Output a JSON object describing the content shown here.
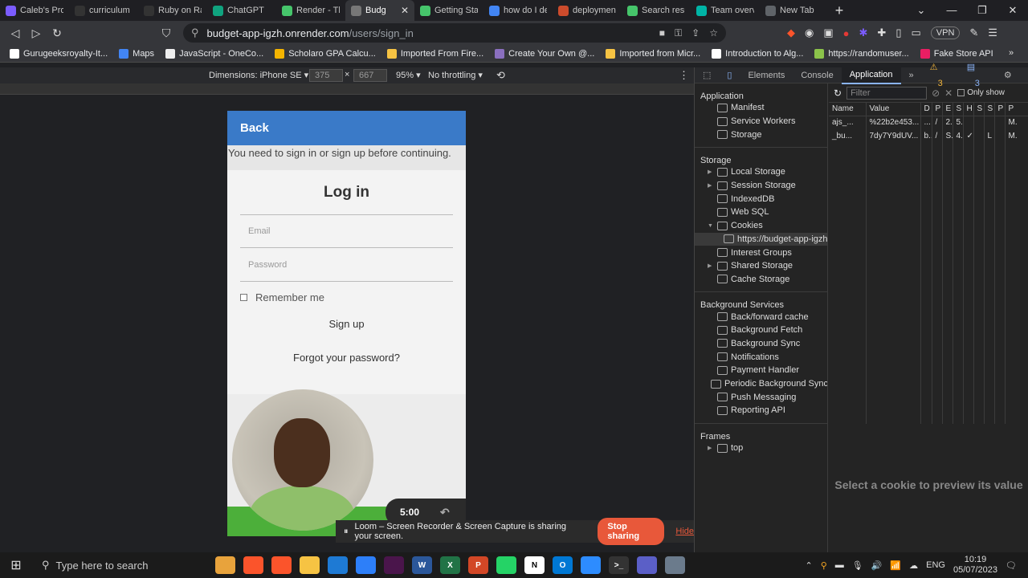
{
  "browser": {
    "tabs": [
      {
        "label": "Caleb's Prog",
        "color": "#7b5cff",
        "active": false
      },
      {
        "label": "curriculum",
        "color": "#333333",
        "active": false
      },
      {
        "label": "Ruby on Ra",
        "color": "#333333",
        "active": false
      },
      {
        "label": "ChatGPT",
        "color": "#10a37f",
        "active": false
      },
      {
        "label": "Render - The",
        "color": "#46c56b",
        "active": false
      },
      {
        "label": "Budg",
        "color": "#777777",
        "active": true
      },
      {
        "label": "Getting Star",
        "color": "#46c56b",
        "active": false
      },
      {
        "label": "how do I de",
        "color": "#4285f4",
        "active": false
      },
      {
        "label": "deployment",
        "color": "#cc4b2c",
        "active": false
      },
      {
        "label": "Search resul",
        "color": "#46c56b",
        "active": false
      },
      {
        "label": "Team overv",
        "color": "#00b4a6",
        "active": false
      },
      {
        "label": "New Tab",
        "color": "#5f6368",
        "active": false
      }
    ],
    "url_host": "budget-app-igzh.onrender.com",
    "url_path": "/users/sign_in",
    "vpn_label": "VPN",
    "bookmarks": [
      {
        "label": "Gurugeeksroyalty-It...",
        "color": "#ffffff"
      },
      {
        "label": "Maps",
        "color": "#4285f4"
      },
      {
        "label": "JavaScript - OneCo...",
        "color": "#eeeeee"
      },
      {
        "label": "Scholaro GPA Calcu...",
        "color": "#f4b400"
      },
      {
        "label": "Imported From Fire...",
        "color": "#f6c343"
      },
      {
        "label": "Create Your Own @...",
        "color": "#8a6fbf"
      },
      {
        "label": "Imported from Micr...",
        "color": "#f6c343"
      },
      {
        "label": "Introduction to Alg...",
        "color": "#ffffff"
      },
      {
        "label": "https://randomuser...",
        "color": "#8bc34a"
      },
      {
        "label": "Fake Store API",
        "color": "#e91e63"
      }
    ]
  },
  "device_toolbar": {
    "dimensions_label": "Dimensions: iPhone SE",
    "width": "375",
    "height": "667",
    "zoom": "95%",
    "throttle": "No throttling",
    "times": "×"
  },
  "phone": {
    "back_label": "Back",
    "notice": "You need to sign in or sign up before continuing.",
    "title": "Log in",
    "email_placeholder": "Email",
    "password_placeholder": "Password",
    "remember_label": "Remember me",
    "signup_label": "Sign up",
    "forgot_label": "Forgot your password?",
    "timer": "5:00"
  },
  "loom": {
    "message": "Loom – Screen Recorder & Screen Capture is sharing your screen.",
    "stop_label": "Stop sharing",
    "hide_label": "Hide"
  },
  "devtools": {
    "tabs": [
      "Elements",
      "Console",
      "Application"
    ],
    "warnings": "3",
    "messages": "3",
    "sections": {
      "application": {
        "title": "Application",
        "items": [
          "Manifest",
          "Service Workers",
          "Storage"
        ]
      },
      "storage": {
        "title": "Storage",
        "items": [
          "Local Storage",
          "Session Storage",
          "IndexedDB",
          "Web SQL",
          "Cookies"
        ],
        "cookie_origin": "https://budget-app-igzh.o",
        "items2": [
          "Interest Groups",
          "Shared Storage",
          "Cache Storage"
        ]
      },
      "background": {
        "title": "Background Services",
        "items": [
          "Back/forward cache",
          "Background Fetch",
          "Background Sync",
          "Notifications",
          "Payment Handler",
          "Periodic Background Sync",
          "Push Messaging",
          "Reporting API"
        ]
      },
      "frames": {
        "title": "Frames",
        "items": [
          "top"
        ]
      }
    },
    "filter_placeholder": "Filter",
    "only_show_label": "Only show",
    "cookie_columns": [
      "Name",
      "Value",
      "D",
      "P",
      "E",
      "S",
      "H",
      "S",
      "S",
      "P",
      "P"
    ],
    "cookie_rows": [
      [
        "ajs_...",
        "%22b2e453...",
        "...",
        "/",
        "2...",
        "5...",
        "",
        "",
        "",
        "",
        "M."
      ],
      [
        "_bu...",
        "7dy7Y9dUV...",
        "b...",
        "/",
        "S...",
        "4...",
        "✓",
        "",
        "L",
        "",
        "M."
      ]
    ],
    "preview_text": "Select a cookie to preview its value"
  },
  "taskbar": {
    "search_placeholder": "Type here to search",
    "language": "ENG",
    "time": "10:19",
    "date": "05/07/2023",
    "apps": [
      {
        "name": "file-explorer",
        "color": "#e8a33c",
        "glyph": ""
      },
      {
        "name": "brave",
        "color": "#fb542b",
        "glyph": ""
      },
      {
        "name": "brave-active",
        "color": "#fb542b",
        "glyph": ""
      },
      {
        "name": "folder",
        "color": "#f6c343",
        "glyph": ""
      },
      {
        "name": "vscode",
        "color": "#1e7ad4",
        "glyph": ""
      },
      {
        "name": "store",
        "color": "#2d7ff9",
        "glyph": ""
      },
      {
        "name": "slack",
        "color": "#4a154b",
        "glyph": ""
      },
      {
        "name": "word",
        "color": "#2b579a",
        "glyph": "W"
      },
      {
        "name": "excel",
        "color": "#217346",
        "glyph": "X"
      },
      {
        "name": "powerpoint",
        "color": "#d24726",
        "glyph": "P"
      },
      {
        "name": "whatsapp",
        "color": "#25d366",
        "glyph": ""
      },
      {
        "name": "notion",
        "color": "#ffffff",
        "glyph": "N"
      },
      {
        "name": "outlook",
        "color": "#0078d4",
        "glyph": "O"
      },
      {
        "name": "zoom",
        "color": "#2d8cff",
        "glyph": ""
      },
      {
        "name": "terminal",
        "color": "#333333",
        "glyph": ">_"
      },
      {
        "name": "teams",
        "color": "#5b5fc7",
        "glyph": ""
      },
      {
        "name": "app",
        "color": "#6b7b8c",
        "glyph": ""
      }
    ]
  }
}
